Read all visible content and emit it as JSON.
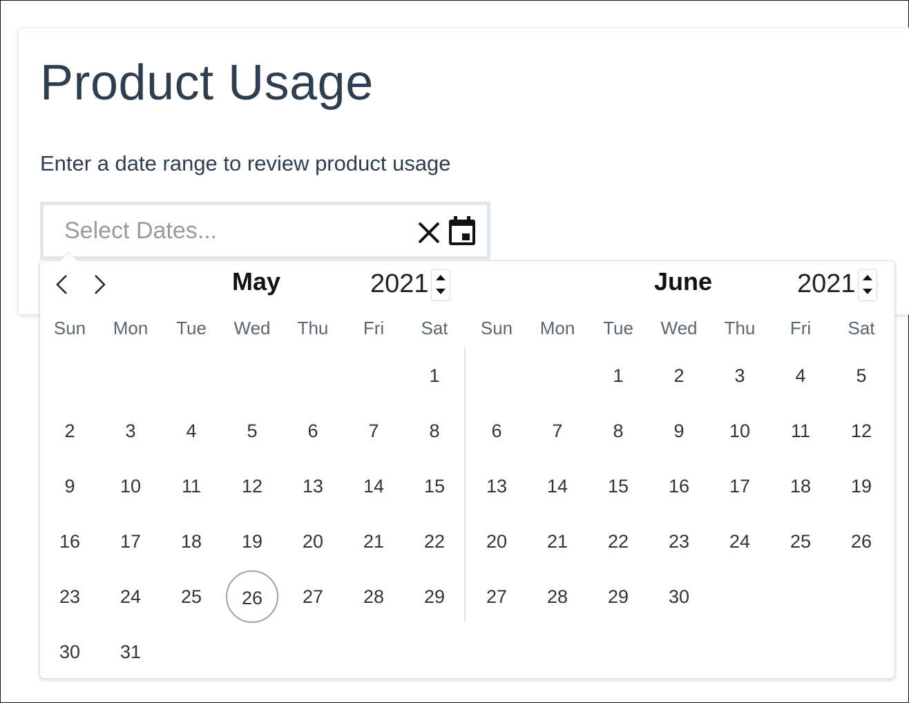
{
  "page": {
    "title": "Product Usage",
    "subtitle": "Enter a date range to review product usage"
  },
  "date_input": {
    "placeholder": "Select Dates...",
    "value": "",
    "clear_icon": "close-icon",
    "calendar_icon": "calendar-icon"
  },
  "picker": {
    "prev_icon": "chevron-left-icon",
    "next_icon": "chevron-right-icon",
    "weekdays": [
      "Sun",
      "Mon",
      "Tue",
      "Wed",
      "Thu",
      "Fri",
      "Sat"
    ],
    "today_ring_color": "#9aa0a6",
    "months": [
      {
        "name": "May",
        "year": "2021",
        "first_weekday": 6,
        "days_in_month": 31,
        "highlighted_day": 26
      },
      {
        "name": "June",
        "year": "2021",
        "first_weekday": 2,
        "days_in_month": 30,
        "highlighted_day": null
      }
    ]
  }
}
